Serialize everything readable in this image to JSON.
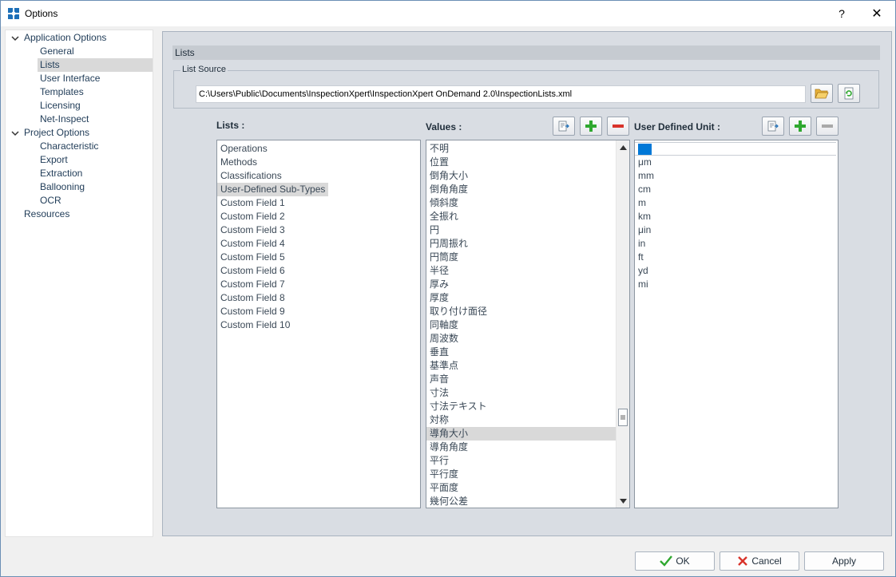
{
  "window": {
    "title": "Options",
    "help_label": "?",
    "close_label": "✕"
  },
  "tree": {
    "items": [
      {
        "label": "Application Options",
        "group": true
      },
      {
        "label": "General"
      },
      {
        "label": "Lists",
        "selected": true
      },
      {
        "label": "User Interface"
      },
      {
        "label": "Templates"
      },
      {
        "label": "Licensing"
      },
      {
        "label": "Net-Inspect"
      },
      {
        "label": "Project Options",
        "group": true
      },
      {
        "label": "Characteristic"
      },
      {
        "label": "Export"
      },
      {
        "label": "Extraction"
      },
      {
        "label": "Ballooning"
      },
      {
        "label": "OCR"
      },
      {
        "label": "Resources",
        "group": true,
        "leaf": true
      }
    ]
  },
  "panel": {
    "header": "Lists",
    "list_source": {
      "legend": "List Source",
      "path": "C:\\Users\\Public\\Documents\\InspectionXpert\\InspectionXpert OnDemand 2.0\\InspectionLists.xml"
    },
    "lists_label": "Lists :",
    "values_label": "Values :",
    "units_label": "User Defined Unit :",
    "lists": [
      "Operations",
      "Methods",
      "Classifications",
      "User-Defined Sub-Types",
      "Custom Field 1",
      "Custom Field 2",
      "Custom Field 3",
      "Custom Field 4",
      "Custom Field 5",
      "Custom Field 6",
      "Custom Field 7",
      "Custom Field 8",
      "Custom Field 9",
      "Custom Field 10"
    ],
    "lists_selected": 3,
    "values": [
      "不明",
      "位置",
      "倒角大小",
      "倒角角度",
      "傾斜度",
      "全振れ",
      "円",
      "円周振れ",
      "円筒度",
      "半径",
      "厚み",
      "厚度",
      "取り付け面径",
      "同軸度",
      "周波数",
      "垂直",
      "基準点",
      "声音",
      "寸法",
      "寸法テキスト",
      "対称",
      "導角大小",
      "導角角度",
      "平行",
      "平行度",
      "平面度",
      "幾何公差"
    ],
    "values_selected": 21,
    "units": [
      "nm",
      "μm",
      "mm",
      "cm",
      "m",
      "km",
      "μin",
      "in",
      "ft",
      "yd",
      "mi"
    ],
    "units_selected": 0
  },
  "buttons": {
    "ok": "OK",
    "cancel": "Cancel",
    "apply": "Apply"
  },
  "colors": {
    "accent": "#0078d7",
    "add": "#2fa82f",
    "remove": "#d9342b"
  }
}
